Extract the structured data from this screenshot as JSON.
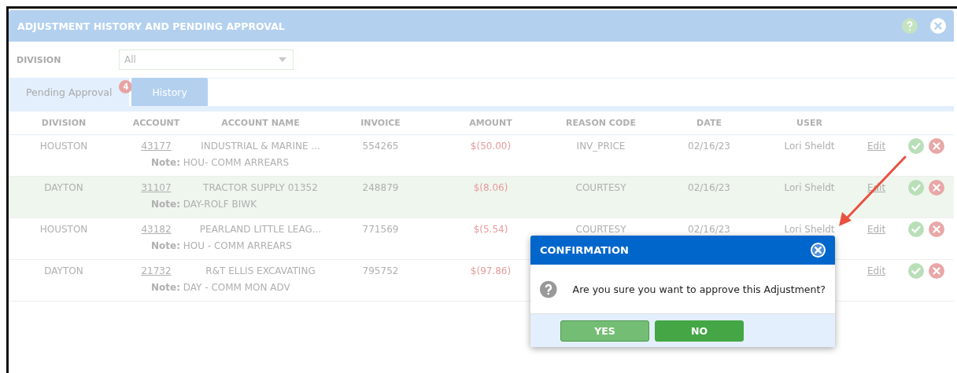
{
  "window": {
    "title": "ADJUSTMENT HISTORY AND PENDING APPROVAL"
  },
  "filter": {
    "label": "DIVISION",
    "value": "All"
  },
  "tabs": [
    {
      "label": "Pending Approval",
      "selected": true,
      "badge": "4"
    },
    {
      "label": "History",
      "selected": false
    }
  ],
  "table": {
    "columns": [
      "DIVISION",
      "ACCOUNT",
      "ACCOUNT NAME",
      "INVOICE",
      "AMOUNT",
      "REASON CODE",
      "DATE",
      "USER"
    ],
    "rows": [
      {
        "division": "HOUSTON",
        "account": "43177",
        "account_name": "INDUSTRIAL & MARINE ...",
        "invoice": "554265",
        "amount": "$(50.00)",
        "reason_code": "INV_PRICE",
        "date": "02/16/23",
        "user": "Lori Sheldt",
        "action": "Edit",
        "note": "**Note:** HOU- COMM ARREARS",
        "highlighted": false
      },
      {
        "division": "DAYTON",
        "account": "31107",
        "account_name": "TRACTOR SUPPLY 01352",
        "invoice": "248879",
        "amount": "$(8.06)",
        "reason_code": "COURTESY",
        "date": "02/16/23",
        "user": "Lori Sheldt",
        "action": "Edit",
        "note": "**Note:** DAY-ROLF BIWK",
        "highlighted": true
      },
      {
        "division": "HOUSTON",
        "account": "43182",
        "account_name": "PEARLAND LITTLE LEAG...",
        "invoice": "771569",
        "amount": "$(5.54)",
        "reason_code": "COURTESY",
        "date": "02/16/23",
        "user": "Lori Sheldt",
        "action": "Edit",
        "note": "**Note:** HOU - COMM ARREARS",
        "highlighted": false
      },
      {
        "division": "DAYTON",
        "account": "21732",
        "account_name": "R&T ELLIS EXCAVATING",
        "invoice": "795752",
        "amount": "$(97.86)",
        "action": "Edit",
        "note": "**Note:** DAY - COMM MON ADV",
        "highlighted": false
      }
    ]
  },
  "dialog": {
    "title": "CONFIRMATION",
    "message": "Are you sure you want to approve this Adjustment?",
    "buttons": [
      {
        "label": "YES",
        "kind": "secondary"
      },
      {
        "label": "NO",
        "kind": "primary"
      }
    ]
  }
}
